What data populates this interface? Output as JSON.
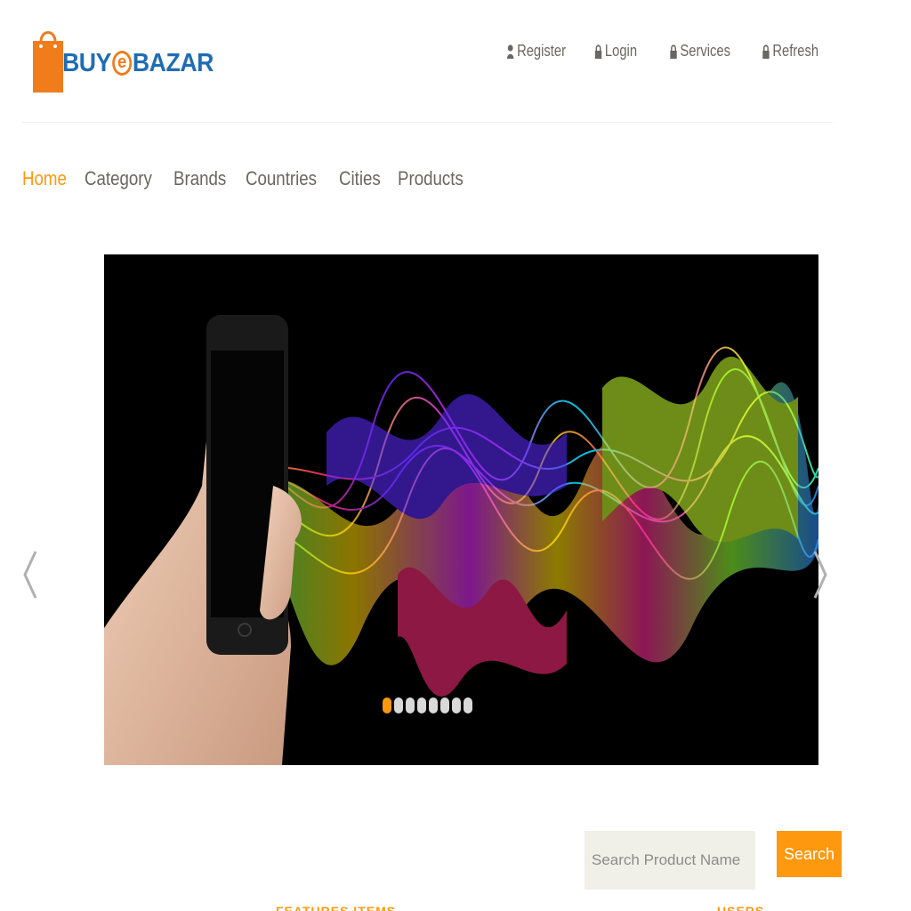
{
  "brand": {
    "name_prefix": "BUY",
    "name_e": "e",
    "name_suffix": "BAZAR",
    "colors": {
      "blue": "#1f6db4",
      "orange": "#f07c1c"
    }
  },
  "top_links": [
    {
      "label": "Register",
      "icon": "user-icon"
    },
    {
      "label": "Login",
      "icon": "lock-icon"
    },
    {
      "label": "Services",
      "icon": "lock-icon"
    },
    {
      "label": "Refresh",
      "icon": "lock-icon"
    }
  ],
  "nav": {
    "items": [
      {
        "label": "Home",
        "active": true
      },
      {
        "label": "Category",
        "active": false
      },
      {
        "label": "Brands",
        "active": false
      },
      {
        "label": "Countries",
        "active": false
      },
      {
        "label": "Cities",
        "active": false
      },
      {
        "label": "Products",
        "active": false
      }
    ],
    "active_color": "#fe980f"
  },
  "slider": {
    "slide_count": 8,
    "active_index": 0,
    "prev_icon": "chevron-left-icon",
    "next_icon": "chevron-right-icon"
  },
  "search": {
    "placeholder": "Search Product Name",
    "value": "",
    "button_label": "Search"
  },
  "sections": {
    "featured_title": "FEATURES ITEMS",
    "other_title": "USERS"
  },
  "colors": {
    "accent": "#fe980f",
    "text": "#696763",
    "input_bg": "#f0f0e9"
  }
}
